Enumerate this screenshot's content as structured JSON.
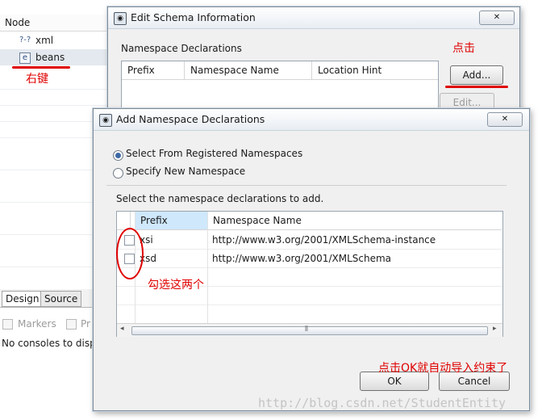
{
  "background": {
    "tree_header": "Node",
    "tree_items": [
      {
        "icon": "?-?",
        "label": "xml"
      },
      {
        "icon": "e",
        "label": "beans"
      }
    ],
    "bottom_tabs": [
      "Design",
      "Source"
    ],
    "console_tabs": [
      "Markers",
      "Pr"
    ],
    "console_message": "No consoles to disp"
  },
  "edit_dialog": {
    "title": "Edit Schema Information",
    "section_label": "Namespace Declarations",
    "columns": [
      "Prefix",
      "Namespace Name",
      "Location Hint"
    ],
    "add_button": "Add...",
    "edit_button": "Edit..."
  },
  "add_dialog": {
    "title": "Add Namespace Declarations",
    "radio_options": [
      {
        "label": "Select From Registered Namespaces",
        "selected": true
      },
      {
        "label": "Specify New Namespace",
        "selected": false
      }
    ],
    "instruction": "Select the namespace declarations to add.",
    "columns": [
      "Prefix",
      "Namespace Name"
    ],
    "rows": [
      {
        "prefix": "xsi",
        "namespace": "http://www.w3.org/2001/XMLSchema-instance"
      },
      {
        "prefix": "xsd",
        "namespace": "http://www.w3.org/2001/XMLSchema"
      }
    ],
    "ok_button": "OK",
    "cancel_button": "Cancel"
  },
  "annotations": {
    "right_click": "右键",
    "click": "点击",
    "check_these_two": "勾选这两个",
    "click_ok": "点击OK就自动导入约束了"
  },
  "watermark": "http://blog.csdn.net/StudentEntity",
  "colors": {
    "annotation": "#e00000",
    "selection_header": "#cfe8fc"
  }
}
